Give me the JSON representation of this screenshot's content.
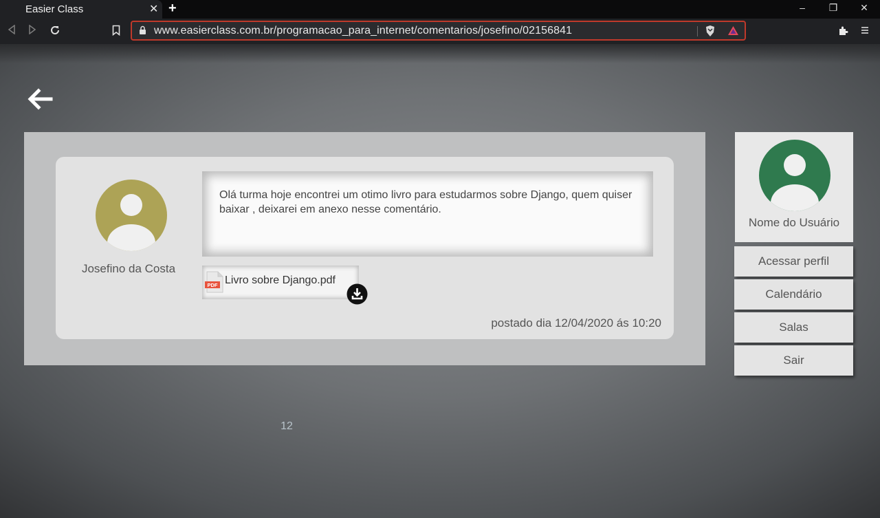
{
  "browser": {
    "tab_title": "Easier Class",
    "tab_close": "✕",
    "new_tab": "+",
    "url": "www.easierclass.com.br/programacao_para_internet/comentarios/josefino/02156841",
    "win_minimize": "–",
    "win_restore": "❐",
    "win_close": "✕"
  },
  "post": {
    "author": "Josefino da Costa",
    "comment": "Olá turma hoje encontrei um otimo livro para estudarmos sobre Django, quem quiser baixar , deixarei em anexo nesse comentário.",
    "attachment_name": "Livro sobre Django.pdf",
    "attachment_badge": "PDF",
    "posted_info": "postado dia 12/04/2020  ás 10:20"
  },
  "pagination": {
    "current": "12"
  },
  "sidebar": {
    "user_name": "Nome do Usuário",
    "buttons": [
      "Acessar perfil",
      "Calendário",
      "Salas",
      "Sair"
    ]
  },
  "colors": {
    "author_avatar": "#ada356",
    "user_avatar": "#2f7a4e",
    "url_outline": "#c0392b"
  }
}
